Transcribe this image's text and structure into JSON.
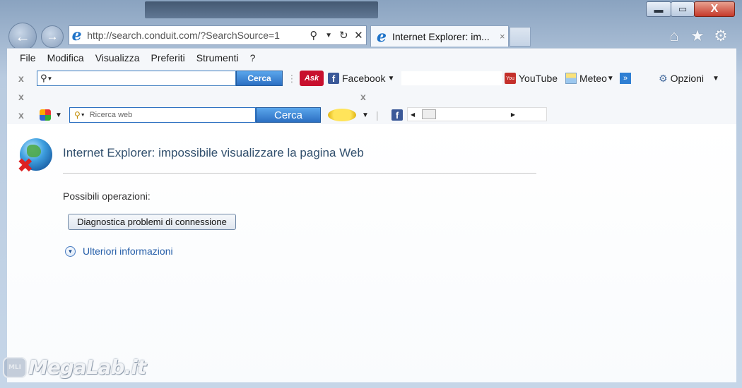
{
  "window": {
    "min_label": "▬",
    "max_label": "▭",
    "close_label": "X"
  },
  "nav": {
    "url": "http://search.conduit.com/?SearchSource=1",
    "tab_title": "Internet Explorer: im...",
    "tab_close": "×"
  },
  "menu": [
    "File",
    "Modifica",
    "Visualizza",
    "Preferiti",
    "Strumenti",
    "?"
  ],
  "toolbar1": {
    "close": "x",
    "search_value": "",
    "search_button": "Cerca",
    "ask_label": "Ask",
    "facebook_label": "Facebook",
    "youtube_label": "YouTube",
    "meteo_label": "Meteo",
    "more_label": "»",
    "options_label": "Opzioni"
  },
  "toolbar2": {
    "close": "x",
    "close2": "x"
  },
  "toolbar3": {
    "close": "x",
    "search_placeholder": "Ricerca web",
    "search_button": "Cerca"
  },
  "page": {
    "title": "Internet Explorer: impossibile visualizzare la pagina Web",
    "operations_label": "Possibili operazioni:",
    "diagnose_button": "Diagnostica problemi di connessione",
    "more_info": "Ulteriori informazioni"
  },
  "watermark": {
    "text": "MegaLab.it",
    "icon_text": "MLI"
  },
  "colors": {
    "link_blue": "#245da8",
    "title_blue": "#32506e",
    "cerca_blue": "#2c6fc2"
  }
}
